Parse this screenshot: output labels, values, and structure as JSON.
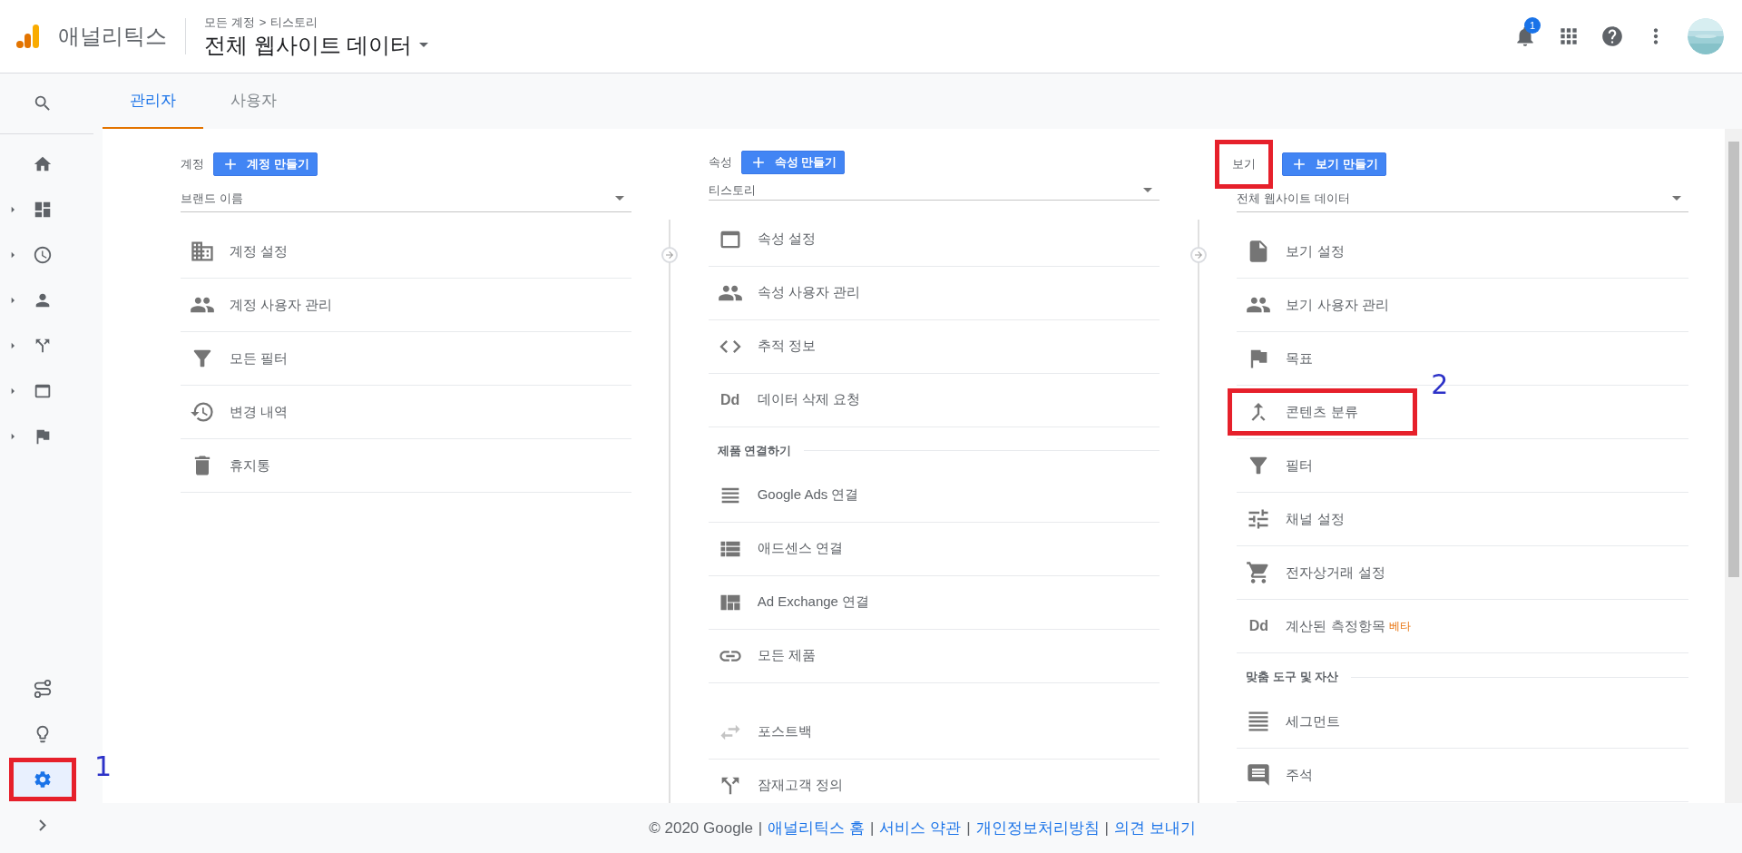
{
  "header": {
    "product": "애널리틱스",
    "breadcrumb": [
      "모든 계정",
      ">",
      "티스토리"
    ],
    "title": "전체 웹사이트 데이터",
    "notification_count": "1"
  },
  "sidebar": {
    "top": [
      {
        "expandable": false,
        "selected": false
      },
      {
        "expandable": false,
        "selected": false
      },
      {
        "expandable": true,
        "selected": false
      },
      {
        "expandable": true,
        "selected": false
      },
      {
        "expandable": true,
        "selected": false
      },
      {
        "expandable": true,
        "selected": false
      },
      {
        "expandable": true,
        "selected": false
      },
      {
        "expandable": true,
        "selected": false
      }
    ],
    "bottom": [
      {
        "selected": false,
        "highlighted": false
      },
      {
        "selected": false,
        "highlighted": false
      },
      {
        "selected": true,
        "highlighted": true,
        "mark_label": "1"
      },
      {
        "selected": false,
        "highlighted": false
      }
    ]
  },
  "tabs": [
    {
      "label": "관리자",
      "selected": true
    },
    {
      "label": "사용자",
      "selected": false
    }
  ],
  "columns": [
    {
      "label": "계정",
      "label_highlighted": false,
      "create_button": "계정 만들기",
      "dropdown": "브랜드 이름",
      "items": [
        {
          "kind": "item",
          "text": "계정 설정"
        },
        {
          "kind": "item",
          "text": "계정 사용자 관리"
        },
        {
          "kind": "item",
          "text": "모든 필터"
        },
        {
          "kind": "item",
          "text": "변경 내역"
        },
        {
          "kind": "item",
          "text": "휴지통"
        }
      ]
    },
    {
      "label": "속성",
      "label_highlighted": false,
      "create_button": "속성 만들기",
      "dropdown": "티스토리",
      "items": [
        {
          "kind": "item",
          "text": "속성 설정"
        },
        {
          "kind": "item",
          "text": "속성 사용자 관리"
        },
        {
          "kind": "item",
          "text": "추적 정보"
        },
        {
          "kind": "item",
          "text": "데이터 삭제 요청",
          "icon_text": "Dd"
        },
        {
          "kind": "section",
          "text": "제품 연결하기"
        },
        {
          "kind": "item",
          "text": "Google Ads 연결"
        },
        {
          "kind": "item",
          "text": "애드센스 연결"
        },
        {
          "kind": "item",
          "text": "Ad Exchange 연결"
        },
        {
          "kind": "item",
          "text": "모든 제품"
        },
        {
          "kind": "item",
          "text": "포스트백",
          "gap_before": true
        },
        {
          "kind": "item",
          "text": "잠재고객 정의"
        }
      ]
    },
    {
      "label": "보기",
      "label_highlighted": true,
      "create_button": "보기 만들기",
      "dropdown": "전체 웹사이트 데이터",
      "items": [
        {
          "kind": "item",
          "text": "보기 설정"
        },
        {
          "kind": "item",
          "text": "보기 사용자 관리"
        },
        {
          "kind": "item",
          "text": "목표"
        },
        {
          "kind": "item",
          "text": "콘텐츠 분류",
          "highlighted": true,
          "mark_label": "2"
        },
        {
          "kind": "item",
          "text": "필터"
        },
        {
          "kind": "item",
          "text": "채널 설정"
        },
        {
          "kind": "item",
          "text": "전자상거래 설정"
        },
        {
          "kind": "item",
          "text": "계산된 측정항목",
          "icon_text": "Dd",
          "badge": "베타"
        },
        {
          "kind": "section",
          "text": "맞춤 도구 및 자산"
        },
        {
          "kind": "item",
          "text": "세그먼트"
        },
        {
          "kind": "item",
          "text": "주석"
        }
      ]
    }
  ],
  "footer": [
    {
      "kind": "text",
      "text": "© 2020 Google"
    },
    {
      "kind": "sep",
      "text": "|"
    },
    {
      "kind": "link",
      "text": "애널리틱스 홈"
    },
    {
      "kind": "sep",
      "text": "|"
    },
    {
      "kind": "link",
      "text": "서비스 약관"
    },
    {
      "kind": "sep",
      "text": "|"
    },
    {
      "kind": "link",
      "text": "개인정보처리방침"
    },
    {
      "kind": "sep",
      "text": "|"
    },
    {
      "kind": "link",
      "text": "의견 보내기"
    }
  ]
}
